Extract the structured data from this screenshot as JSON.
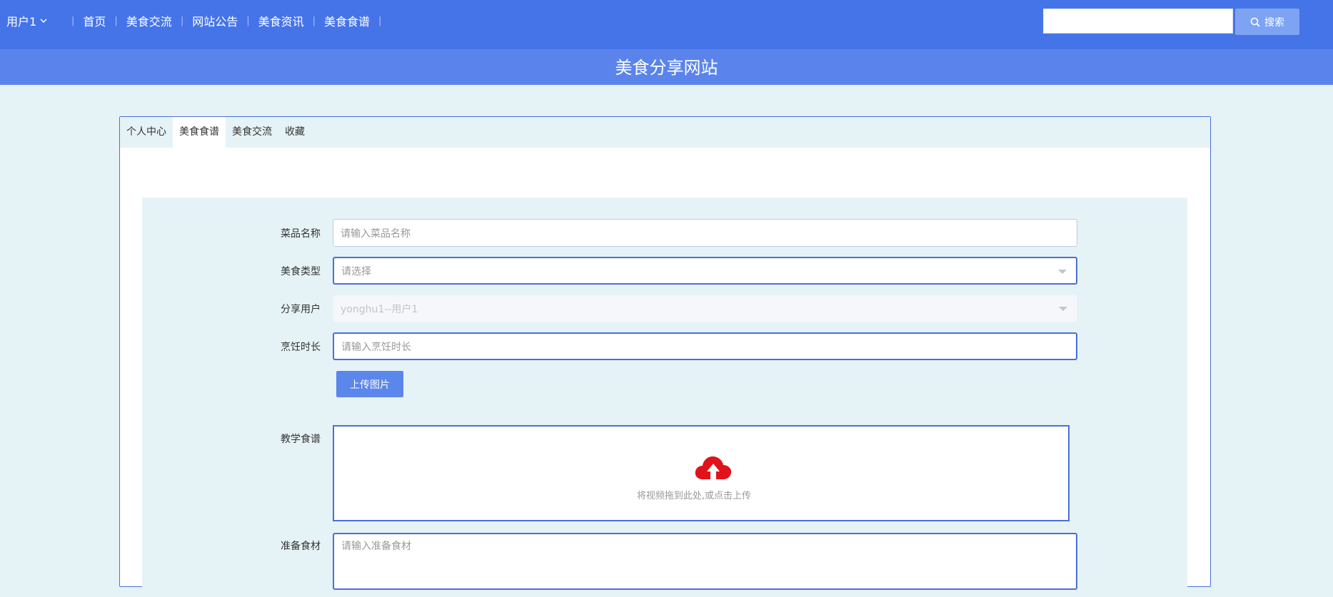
{
  "nav": {
    "user_label": "用户1",
    "links": [
      "首页",
      "美食交流",
      "网站公告",
      "美食资讯",
      "美食食谱"
    ],
    "search_placeholder": "",
    "search_button": "搜索"
  },
  "banner": {
    "title": "美食分享网站"
  },
  "tabs": [
    {
      "label": "个人中心",
      "active": false
    },
    {
      "label": "美食食谱",
      "active": true
    },
    {
      "label": "美食交流",
      "active": false
    },
    {
      "label": "收藏",
      "active": false
    }
  ],
  "form": {
    "dish_name": {
      "label": "菜品名称",
      "placeholder": "请输入菜品名称"
    },
    "food_type": {
      "label": "美食类型",
      "placeholder": "请选择"
    },
    "share_user": {
      "label": "分享用户",
      "value": "yonghu1--用户1"
    },
    "cook_time": {
      "label": "烹饪时长",
      "placeholder": "请输入烹饪时长"
    },
    "upload_image_button": "上传图片",
    "tutorial": {
      "label": "教学食谱",
      "upload_hint": "将视频拖到此处,或点击上传"
    },
    "ingredients": {
      "label": "准备食材",
      "placeholder": "请输入准备食材"
    }
  },
  "colors": {
    "nav_bg": "#4574e8",
    "banner_bg": "#5a84ec",
    "page_bg": "#e6f3f6",
    "accent": "#4a6fd8",
    "upload_icon": "#e0121a"
  },
  "icons": {
    "user_dropdown": "chevron-down-icon",
    "search": "search-icon",
    "select_caret": "caret-down-icon",
    "upload": "cloud-upload-icon"
  }
}
